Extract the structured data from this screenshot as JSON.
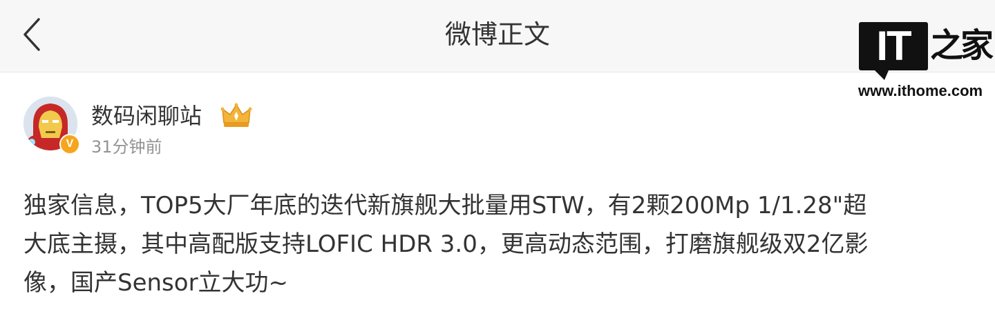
{
  "nav": {
    "back_icon": "chevron-left-icon",
    "title": "微博正文"
  },
  "watermark": {
    "badge_text": "IT",
    "site_cn": "之家",
    "url": "www.ithome.com"
  },
  "author": {
    "name": "数码闲聊站",
    "time": "31分钟前",
    "verified_badge": "V",
    "verified_color": "#f7a51c",
    "crown_icon": "crown-icon"
  },
  "post": {
    "lines": [
      "独家信息，TOP5大厂年底的迭代新旗舰大批量用STW，有2颗200Mp 1/1.28\"超",
      "大底主摄，其中高配版支持LOFIC HDR 3.0，更高动态范围，打磨旗舰级双2亿影",
      "像，国产Sensor立大功~"
    ]
  },
  "colors": {
    "navbar_bg": "#f7f7f7",
    "text": "#333333",
    "secondary_text": "#939393"
  }
}
